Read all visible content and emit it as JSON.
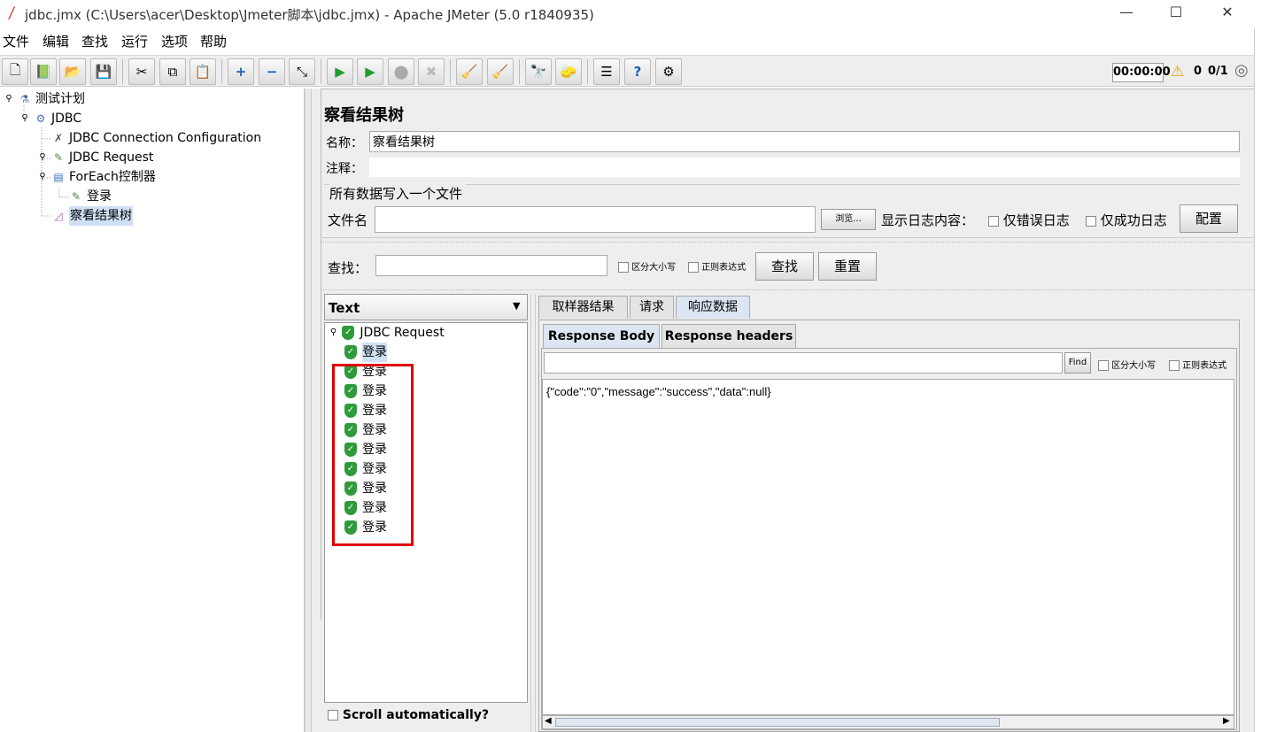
{
  "window": {
    "title": "jdbc.jmx (C:\\Users\\acer\\Desktop\\Jmeter脚本\\jdbc.jmx) - Apache JMeter (5.0 r1840935)",
    "minimize": "—",
    "maximize": "☐",
    "close": "✕"
  },
  "menu": [
    "文件",
    "编辑",
    "查找",
    "运行",
    "选项",
    "帮助"
  ],
  "toolbar": {
    "timer": "00:00:00",
    "warnings": "0",
    "threads": "0/1"
  },
  "tree": [
    {
      "label": "测试计划",
      "icon": "flask-icon"
    },
    {
      "label": "JDBC",
      "icon": "gear-icon"
    },
    {
      "label": "JDBC Connection Configuration",
      "icon": "wrench-icon"
    },
    {
      "label": "JDBC Request",
      "icon": "pipette-icon"
    },
    {
      "label": "ForEach控制器",
      "icon": "loop-icon"
    },
    {
      "label": "登录",
      "icon": "pipette-icon"
    },
    {
      "label": "察看结果树",
      "icon": "chart-icon"
    }
  ],
  "panel": {
    "title": "察看结果树",
    "name_label": "名称：",
    "name_value": "察看结果树",
    "comment_label": "注释：",
    "comment_value": "",
    "file_section": "所有数据写入一个文件",
    "filename_label": "文件名",
    "filename_value": "",
    "browse": "浏览...",
    "log_label": "显示日志内容：",
    "errors_only": "仅错误日志",
    "success_only": "仅成功日志",
    "configure": "配置",
    "search_label": "查找：",
    "case_sensitive": "区分大小写",
    "regex": "正则表达式",
    "search_btn": "查找",
    "reset_btn": "重置"
  },
  "results": {
    "renderer": "Text",
    "root": "JDBC Request",
    "items": [
      "登录",
      "登录",
      "登录",
      "登录",
      "登录",
      "登录",
      "登录",
      "登录",
      "登录",
      "登录"
    ],
    "scroll_auto": "Scroll automatically?"
  },
  "tabs": [
    "取样器结果",
    "请求",
    "响应数据"
  ],
  "subtabs": [
    "Response Body",
    "Response headers"
  ],
  "response": {
    "find": "Find",
    "case_sensitive": "区分大小写",
    "regex": "正则表达式",
    "body": "{\"code\":\"0\",\"message\":\"success\",\"data\":null}"
  },
  "colors": {
    "highlight_box": "#e00000",
    "selection": "#cfe0f5"
  }
}
